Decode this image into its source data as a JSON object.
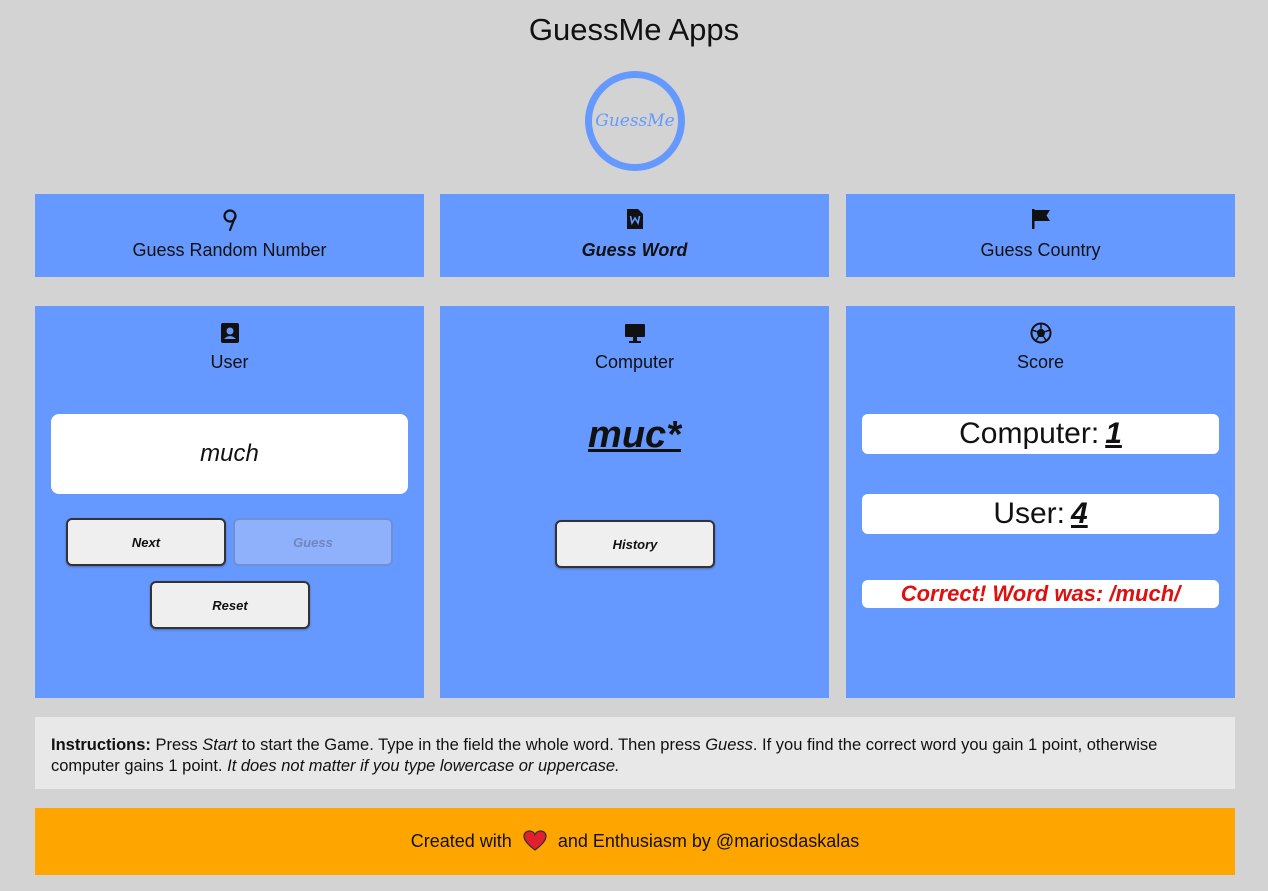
{
  "app": {
    "title": "GuessMe Apps",
    "logo_text": "GuessMe"
  },
  "nav": {
    "items": [
      {
        "label": "Guess Random Number",
        "icon": "number-nine-icon",
        "active": false
      },
      {
        "label": "Guess Word",
        "icon": "word-file-icon",
        "active": true
      },
      {
        "label": "Guess Country",
        "icon": "flag-icon",
        "active": false
      }
    ]
  },
  "user_panel": {
    "header": "User",
    "icon": "user-card-icon",
    "input_value": "much",
    "next_label": "Next",
    "guess_label": "Guess",
    "reset_label": "Reset"
  },
  "computer_panel": {
    "header": "Computer",
    "icon": "monitor-icon",
    "hidden_word": "muc*",
    "history_label": "History"
  },
  "score_panel": {
    "header": "Score",
    "icon": "football-icon",
    "computer_label": "Computer:",
    "computer_score": "1",
    "user_label": "User:",
    "user_score": "4",
    "result": "Correct! Word was: /much/"
  },
  "instructions": {
    "label": "Instructions:",
    "t1": " Press ",
    "start": "Start",
    "t2": " to start the Game. Type in the field the whole word. Then press ",
    "guess": "Guess",
    "t3": ". If you find the correct word you gain 1 point, otherwise computer gains 1 point. ",
    "note": "It does not matter if you type lowercase or uppercase."
  },
  "footer": {
    "prefix": "Created with",
    "suffix": "and Enthusiasm by @mariosdaskalas"
  },
  "colors": {
    "background": "#d3d3d3",
    "card": "#6699ff",
    "footer": "#ffa500",
    "result_text": "#e01010"
  }
}
